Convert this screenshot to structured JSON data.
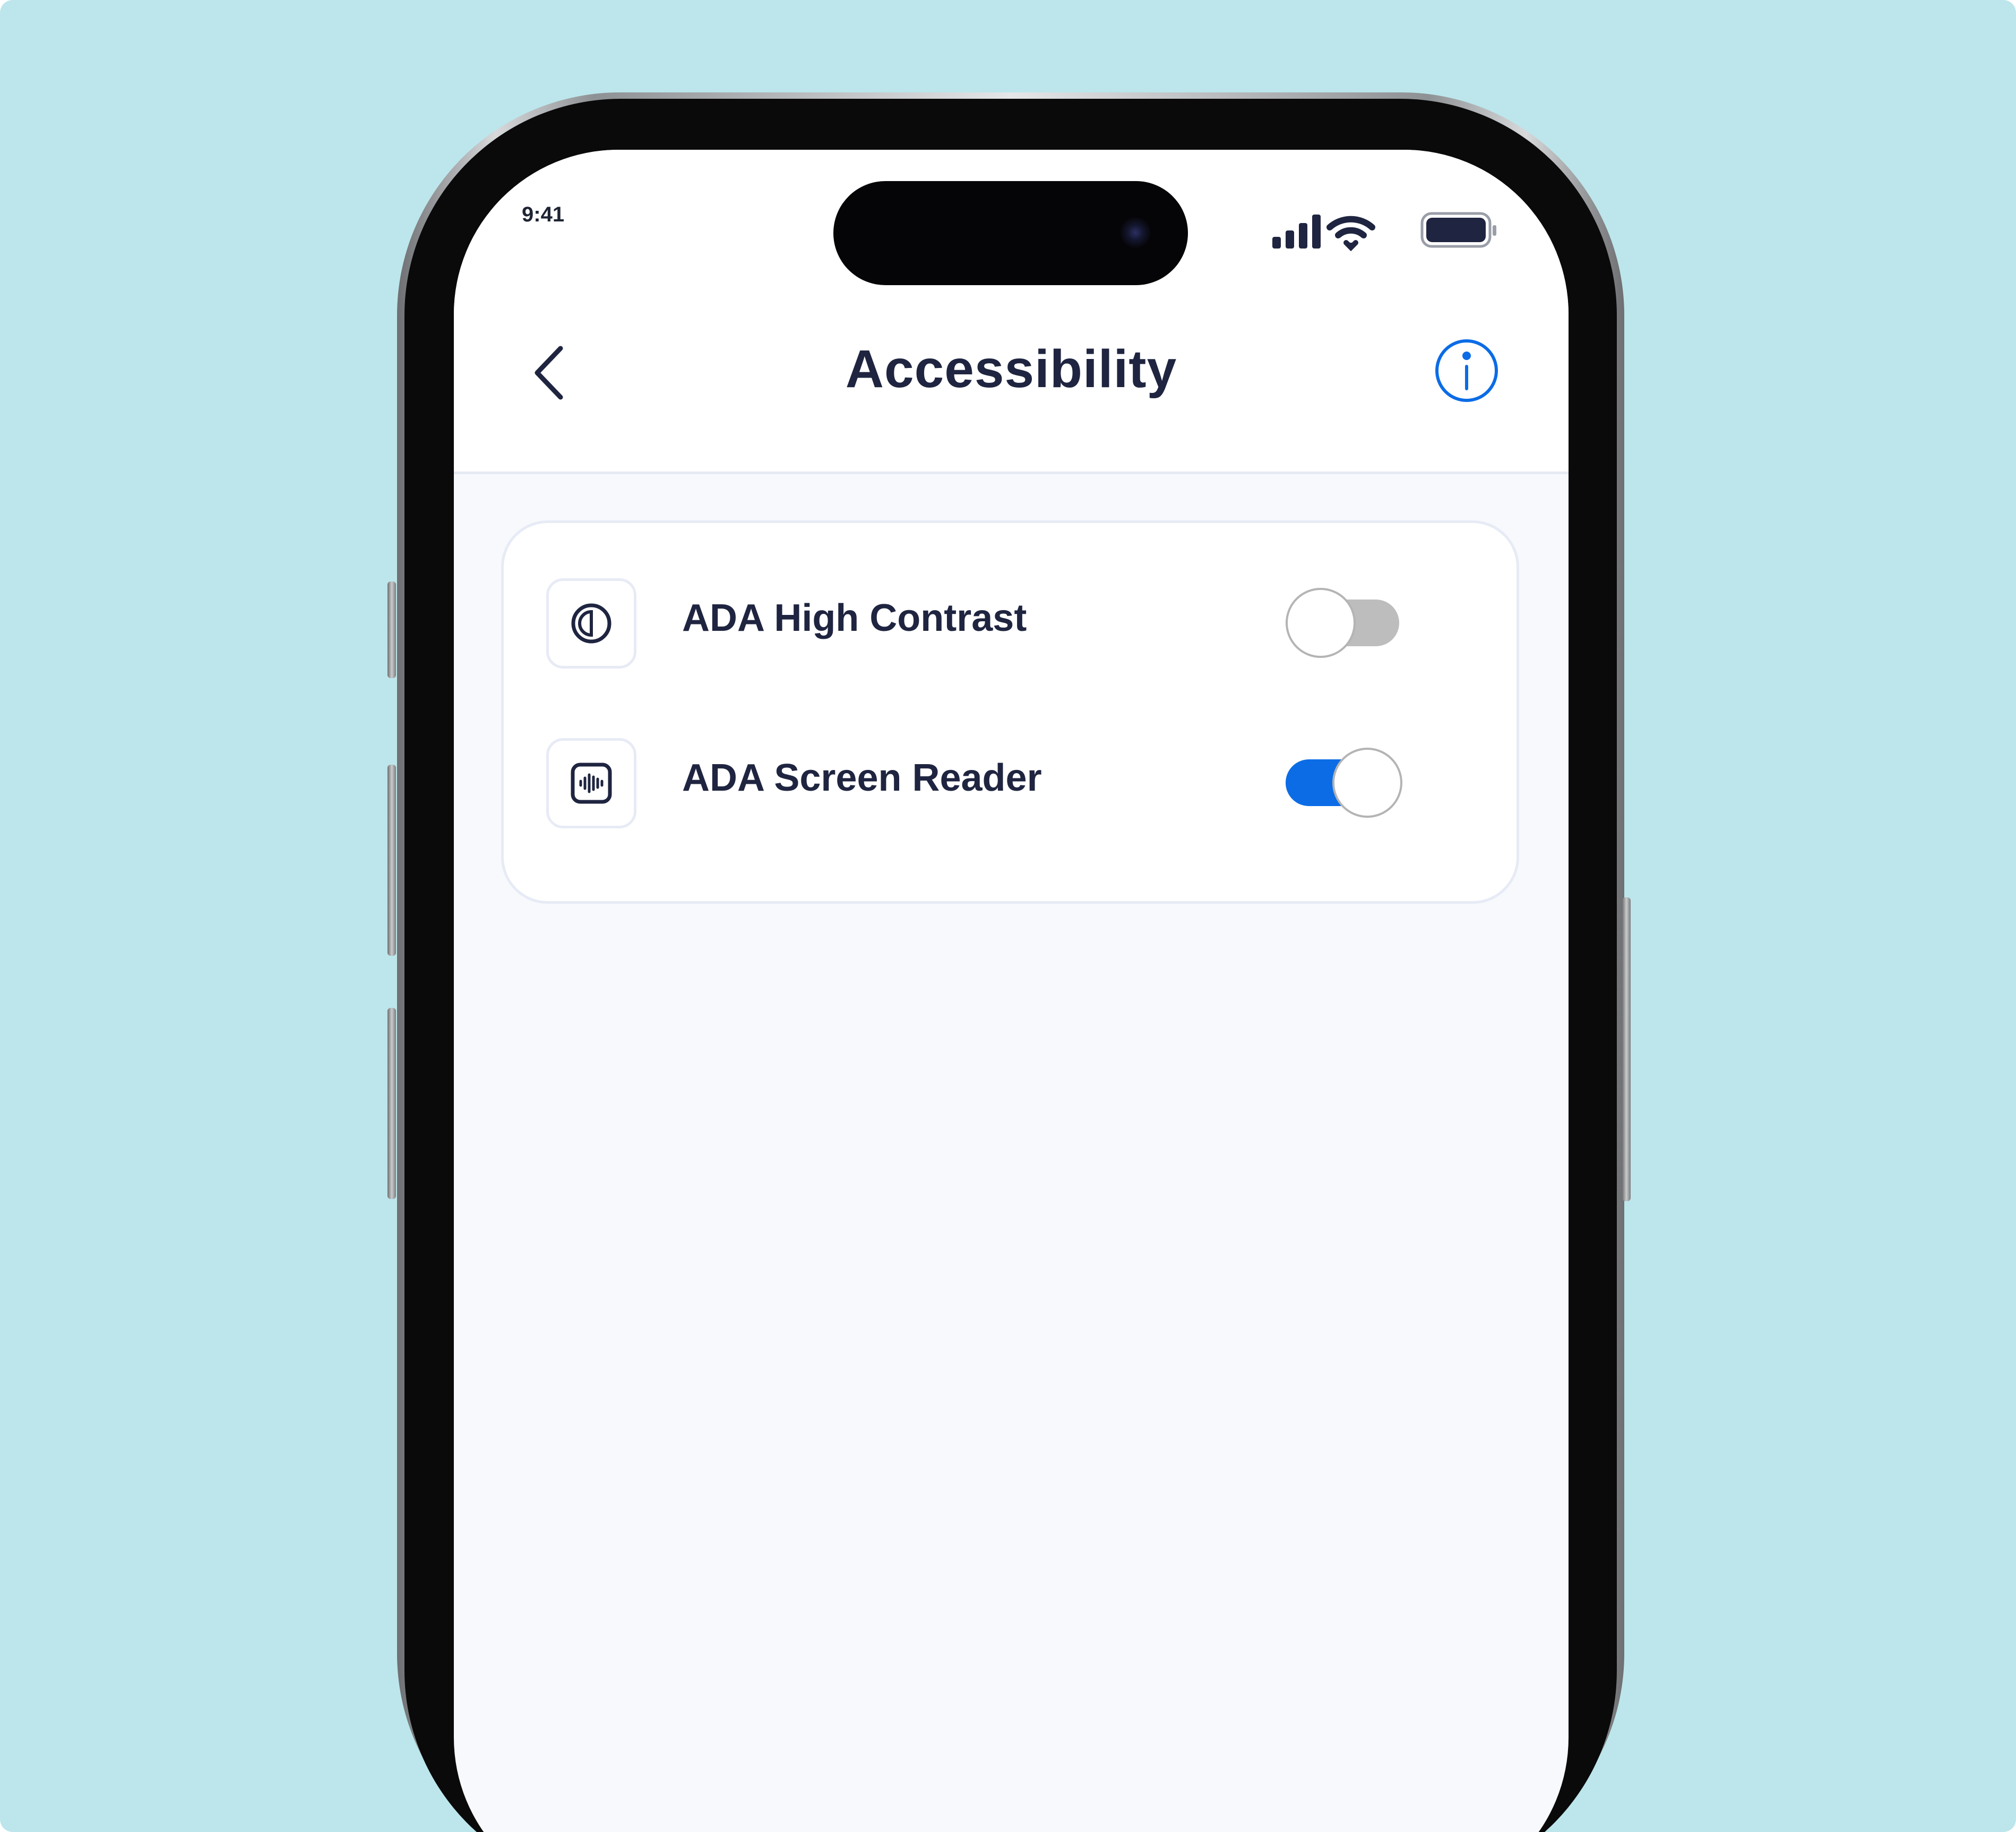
{
  "status_bar": {
    "time": "9:41",
    "signal_icon": "cellular-signal-icon",
    "wifi_icon": "wifi-icon",
    "battery_icon": "battery-icon"
  },
  "nav": {
    "back_icon": "chevron-left-icon",
    "title": "Accessibility",
    "info_icon": "info-icon"
  },
  "settings": [
    {
      "label": "ADA High Contrast",
      "icon": "contrast-icon",
      "enabled": false
    },
    {
      "label": "ADA Screen Reader",
      "icon": "audio-waveform-icon",
      "enabled": true
    }
  ],
  "colors": {
    "background": "#bce6eb",
    "accent": "#0b6ce6",
    "text": "#1f2540",
    "toggle_off": "#bdbdbd",
    "toggle_on": "#0b6ce6"
  }
}
